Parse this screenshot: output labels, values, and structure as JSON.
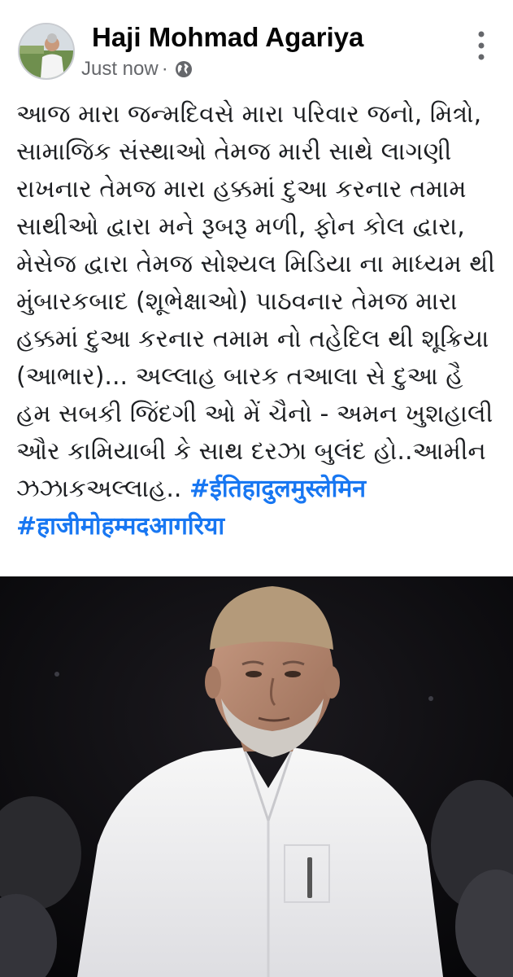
{
  "post": {
    "author": "Haji Mohmad Agariya",
    "timestamp": "Just now",
    "separator": "·",
    "audience_icon": "globe-icon",
    "more_icon": "vertical-ellipsis-icon",
    "text_lines": [
      "આજ મારા જન્મદિવસે મારા પરિવાર જનો, મિત્રો,",
      "સામાજિક સંસ્થાઓ તેમજ મારી સાથે લાગણી",
      "રાખનાર  તેમજ મારા હક્કમાં દુઆ કરનાર તમામ",
      "સાથીઓ દ્વારા મને રૂબરૂ મળી, ફોન કોલ દ્વારા,",
      "મેસેજ દ્વારા તેમજ સોશ્યલ મિડિયા ના માધ્યમ થી",
      "મુંબારકબાદ (શૂભેક્ષાઓ) પાઠવનાર તેમજ મારા",
      "હક્કમાં દુઆ કરનાર તમામ નો તહેદિલ થી શૂક્રિયા",
      "(આભાર)... અલ્લાહ બારક તઆલા સે દુઆ હૈ",
      "હમ સબકી જિંદગી ઓ મેં ચૈનો - અમન ખુશહાલી",
      "ઔર કામિયાબી કે સાથ દરઝા બુલંદ હો..આમીન"
    ],
    "last_line_text": "ઝઝાકઅલ્લાહ.. ",
    "hashtag_1": "#ईतिहादुलमुस्लेमिन",
    "hashtag_2": "#हाजीमोहम्मदआगरिया"
  },
  "colors": {
    "hashtag": "#1877f2",
    "meta": "#65676b",
    "text": "#1c1e21"
  }
}
